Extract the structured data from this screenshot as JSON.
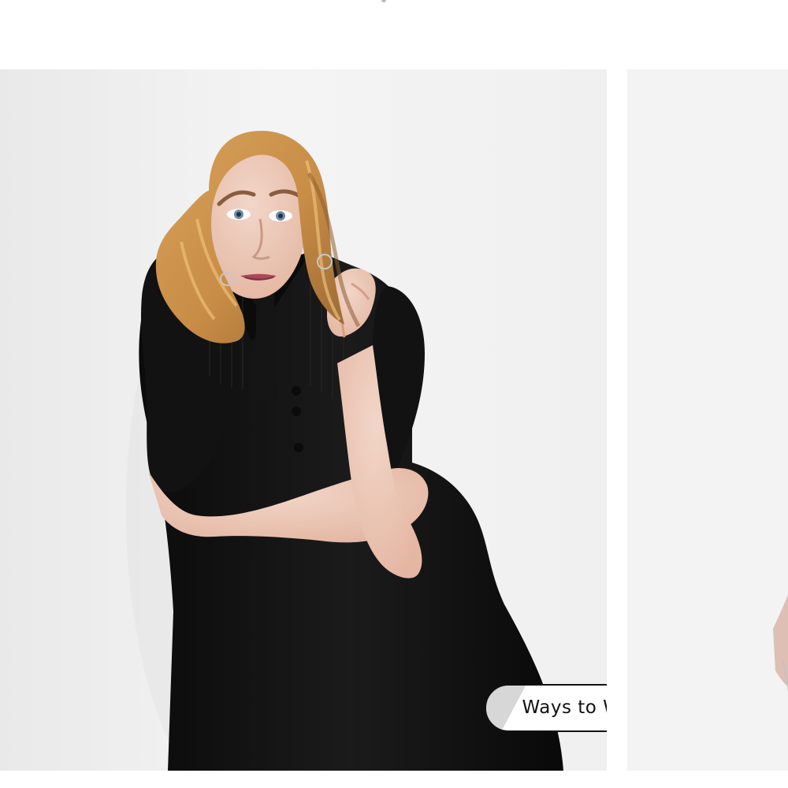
{
  "carousel": {
    "slides": [
      {
        "image": "model-in-black-short-sleeve-dress",
        "button_label": "Ways to Wear it"
      },
      {
        "image": "next-slide-product-image"
      }
    ]
  },
  "colors": {
    "background": "#ffffff",
    "slide_background": "#f2f2f2",
    "dress": "#111111",
    "button_border": "#111111",
    "button_text": "#111111"
  }
}
